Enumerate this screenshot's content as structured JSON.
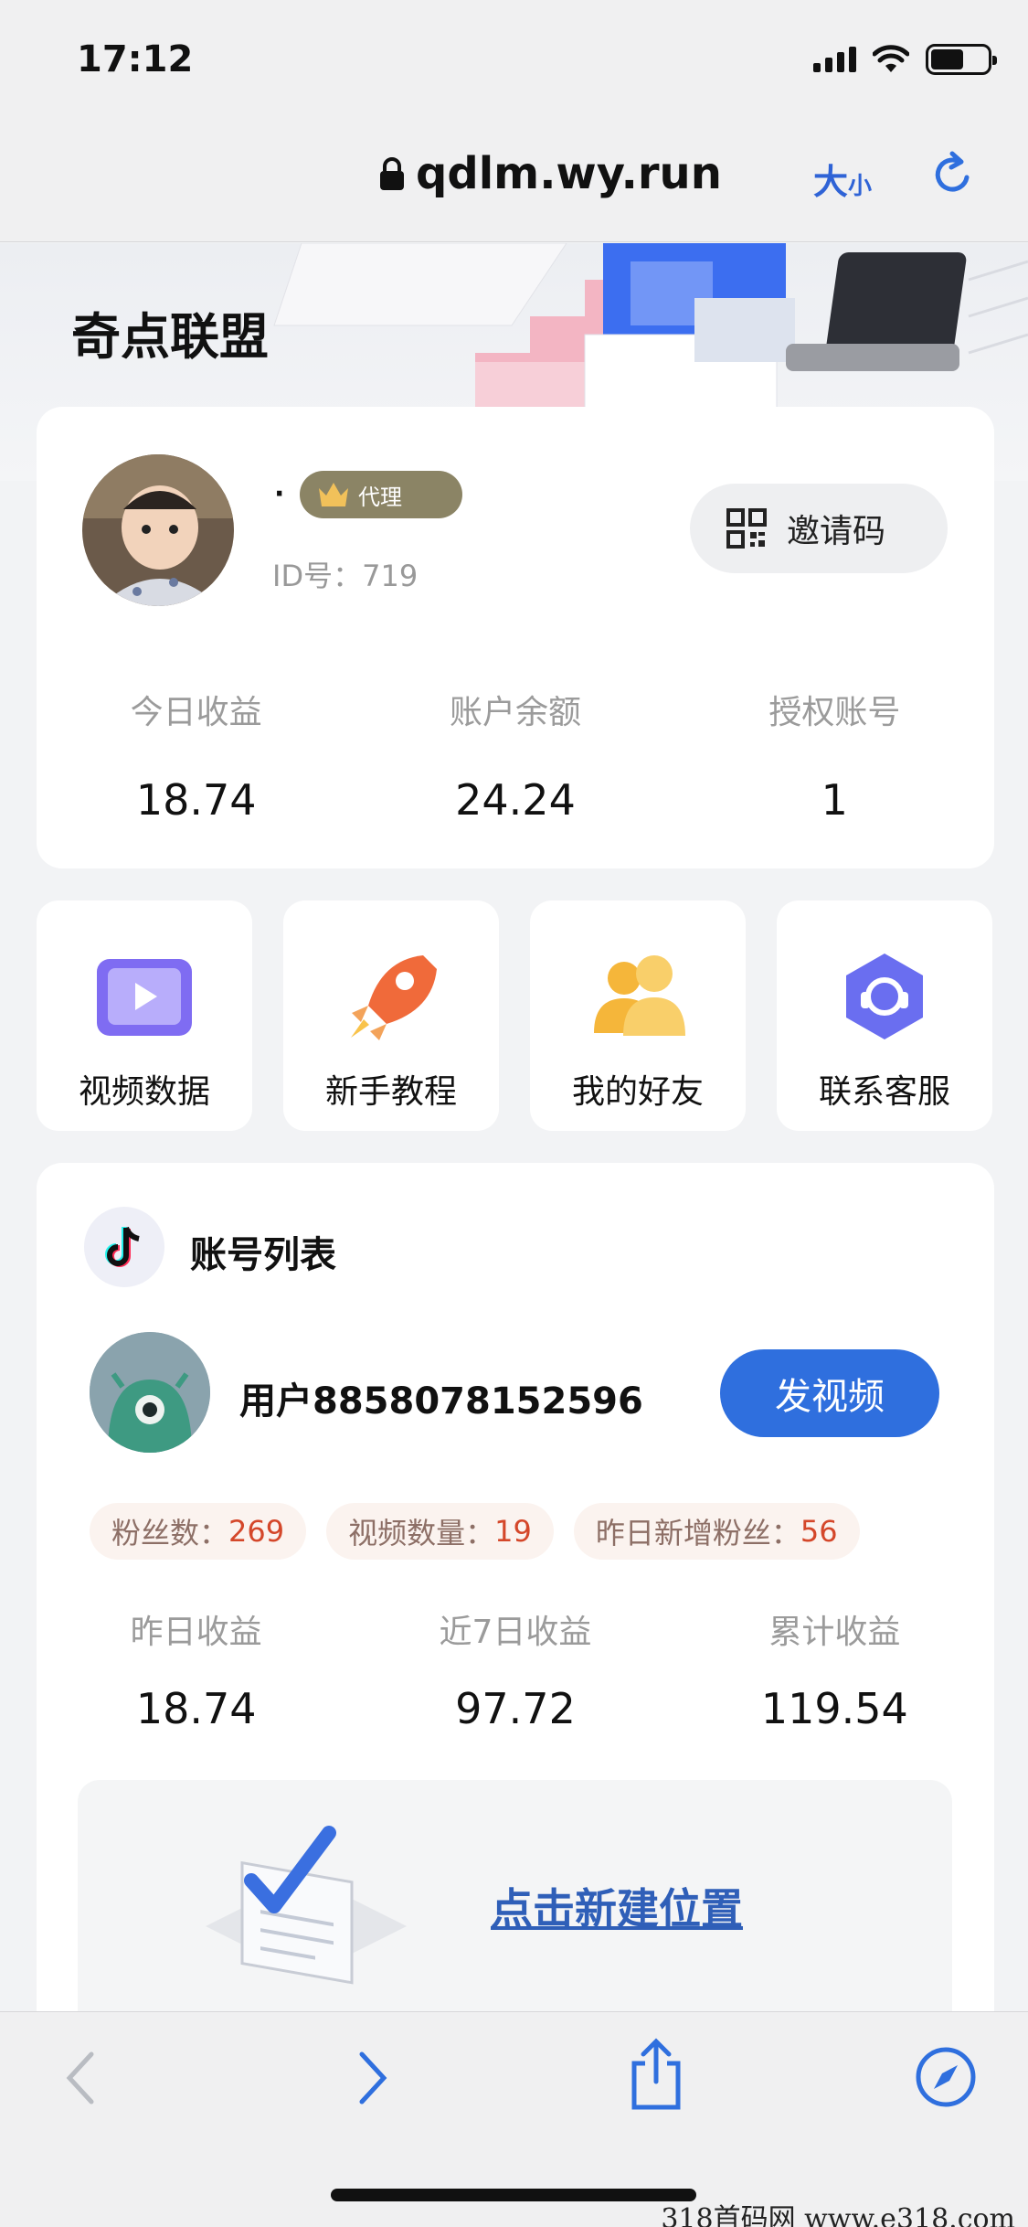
{
  "status": {
    "time": "17:12"
  },
  "browser": {
    "url": "qdlm.wy.run",
    "text_size_big": "大",
    "text_size_small": "小"
  },
  "app": {
    "title": "奇点联盟"
  },
  "profile": {
    "dot": "·",
    "badge": "代理",
    "id_label": "ID号：",
    "id_value": "719",
    "invite_label": "邀请码",
    "stats": [
      {
        "label": "今日收益",
        "value": "18.74"
      },
      {
        "label": "账户余额",
        "value": "24.24"
      },
      {
        "label": "授权账号",
        "value": "1"
      }
    ]
  },
  "menu": [
    {
      "label": "视频数据",
      "icon": "video-icon"
    },
    {
      "label": "新手教程",
      "icon": "rocket-icon"
    },
    {
      "label": "我的好友",
      "icon": "friends-icon"
    },
    {
      "label": "联系客服",
      "icon": "support-icon"
    }
  ],
  "accounts": {
    "title": "账号列表",
    "user": {
      "name": "用户8858078152596",
      "post_label": "发视频",
      "tags": [
        {
          "key": "粉丝数：",
          "value": "269"
        },
        {
          "key": "视频数量：",
          "value": "19"
        },
        {
          "key": "昨日新增粉丝：",
          "value": "56"
        }
      ],
      "stats": [
        {
          "label": "昨日收益",
          "value": "18.74"
        },
        {
          "label": "近7日收益",
          "value": "97.72"
        },
        {
          "label": "累计收益",
          "value": "119.54"
        }
      ]
    },
    "new_position_label": "点击新建位置"
  },
  "watermark": "318首码网 www.e318.com",
  "colors": {
    "accent": "#2f6fde",
    "badge": "#8b8465",
    "tag_value": "#d4472a"
  }
}
